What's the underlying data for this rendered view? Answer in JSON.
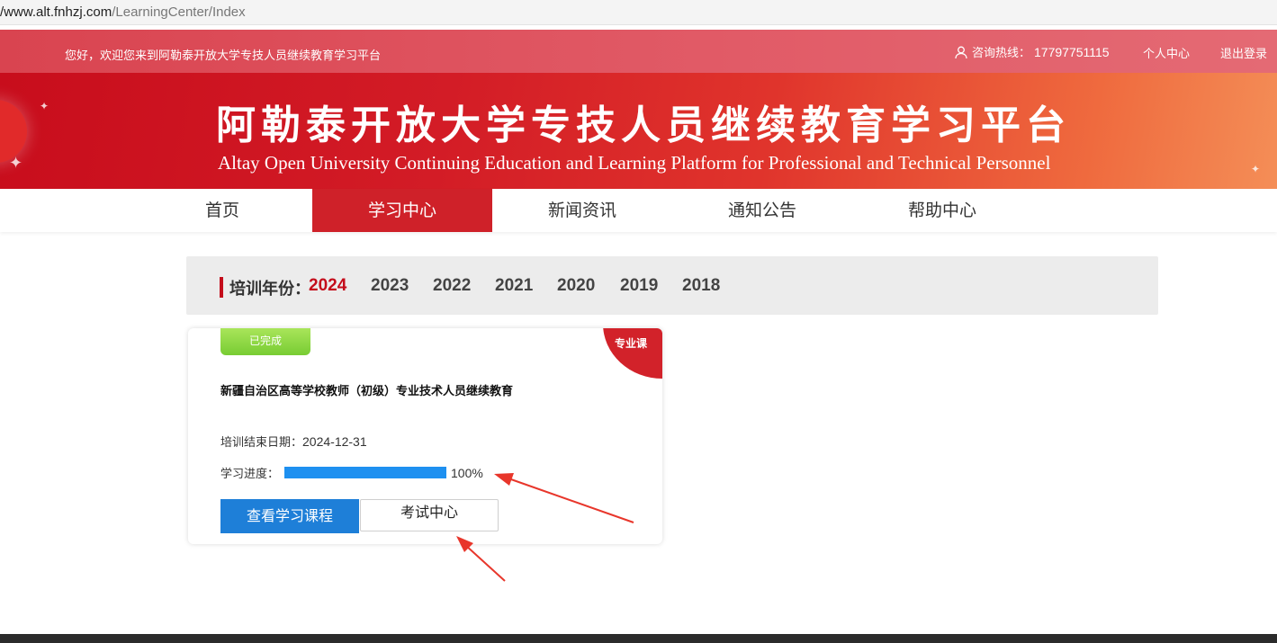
{
  "browser": {
    "url_host": "/www.alt.fnhzj.com",
    "url_path": "/LearningCenter/Index"
  },
  "topbar": {
    "welcome": "您好，欢迎您来到阿勒泰开放大学专技人员继续教育学习平台",
    "hotline_label": "咨询热线：",
    "hotline_number": "17797751115",
    "personal_center": "个人中心",
    "logout": "退出登录"
  },
  "banner": {
    "title": "阿勒泰开放大学专技人员继续教育学习平台",
    "subtitle": "Altay Open University Continuing Education and Learning Platform for Professional and Technical Personnel"
  },
  "nav": {
    "items": [
      "首页",
      "学习中心",
      "新闻资讯",
      "通知公告",
      "帮助中心"
    ],
    "active_index": 1
  },
  "year_filter": {
    "label": "培训年份：",
    "years": [
      "2024",
      "2023",
      "2022",
      "2021",
      "2020",
      "2019",
      "2018"
    ],
    "active": "2024"
  },
  "course_card": {
    "status_badge": "已完成",
    "type_badge": "专业课",
    "title": "新疆自治区高等学校教师（初级）专业技术人员继续教育",
    "end_date_label": "培训结束日期：",
    "end_date": "2024-12-31",
    "progress_label": "学习进度：",
    "progress_value": 1.0,
    "progress_text": "100%",
    "view_button": "查看学习课程",
    "exam_button": "考试中心"
  },
  "colors": {
    "brand_red": "#cf2129",
    "accent_blue": "#1e7fd8",
    "progress_blue": "#1e90f0",
    "badge_green": "#8bd740",
    "annotation_arrow": "#e8362b"
  }
}
